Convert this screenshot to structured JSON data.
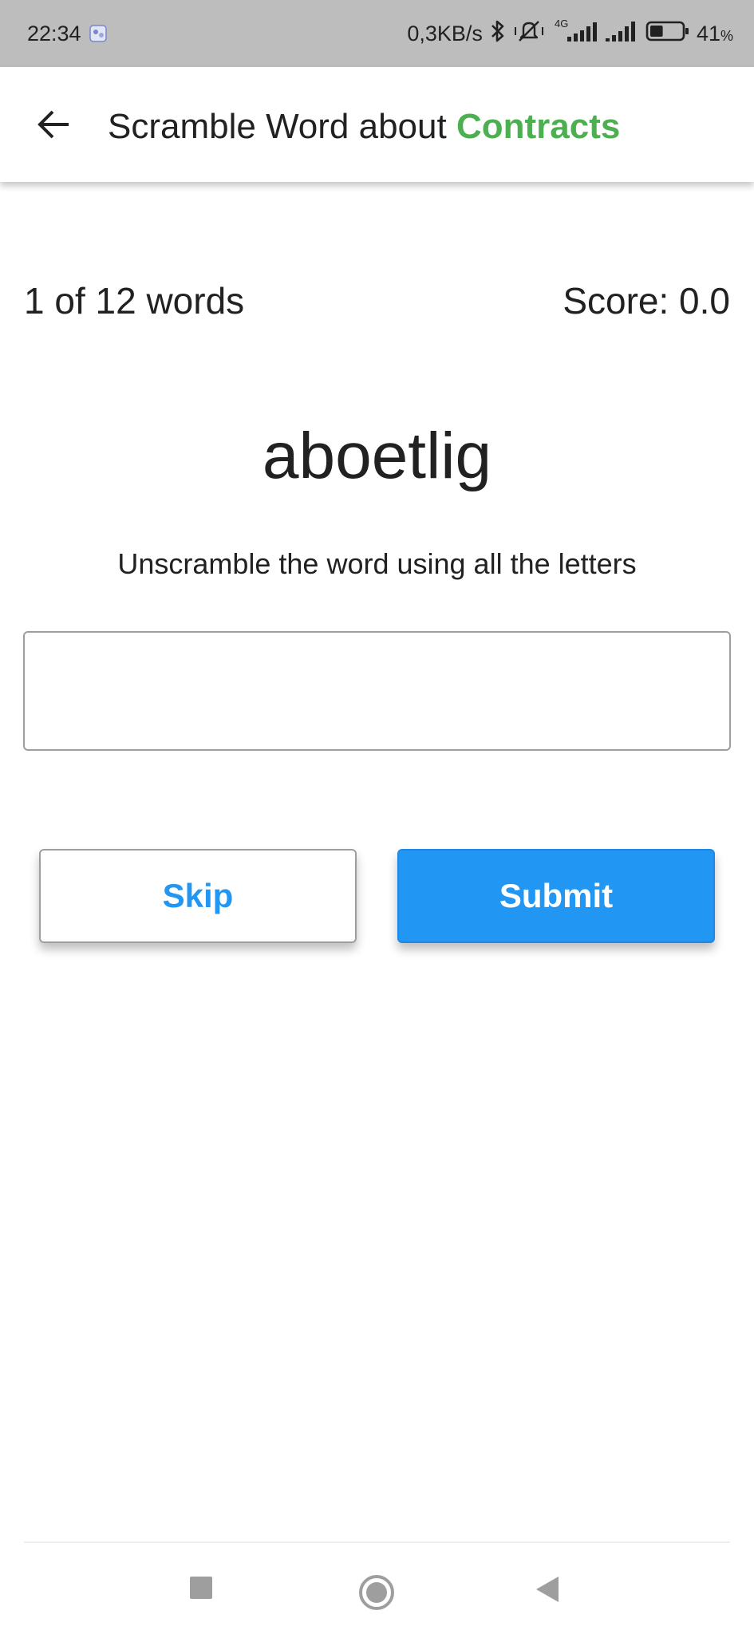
{
  "status_bar": {
    "time": "22:34",
    "network_speed": "0,3KB/s",
    "network_type": "4G",
    "battery_percent": "41",
    "battery_unit": "%",
    "battery_level": 0.41
  },
  "app_bar": {
    "title_prefix": "Scramble Word about ",
    "title_topic": "Contracts",
    "topic_color": "#4caf50"
  },
  "game": {
    "progress_text": "1 of 12 words",
    "score_text": "Score: 0.0",
    "scrambled_word": "aboetlig",
    "instruction": "Unscramble the word using all the letters",
    "answer_value": "",
    "answer_placeholder": ""
  },
  "buttons": {
    "skip_label": "Skip",
    "submit_label": "Submit",
    "accent_color": "#2196f3"
  },
  "nav": {
    "recents_icon": "square-icon",
    "home_icon": "circle-icon",
    "back_icon": "triangle-back-icon"
  }
}
